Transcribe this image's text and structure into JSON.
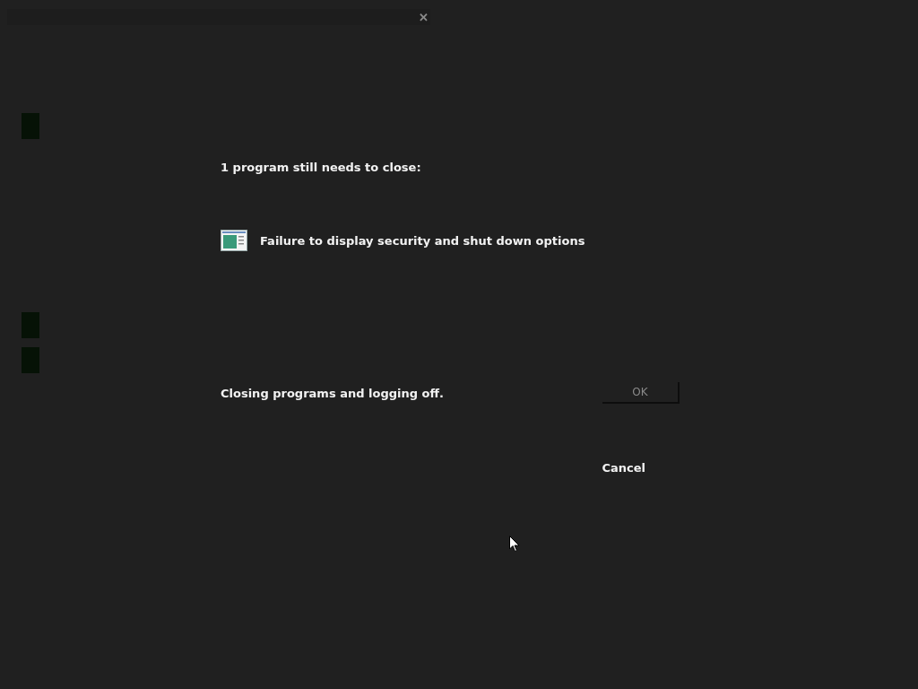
{
  "title_bar": {
    "close": "✕"
  },
  "message": "1 program still needs to close:",
  "programs": [
    {
      "name": "Failure to display security and shut down options"
    }
  ],
  "status": "Closing programs and logging off.",
  "buttons": [
    {
      "label": "OK",
      "disabled": true
    },
    {
      "label": "Cancel",
      "disabled": false
    }
  ]
}
